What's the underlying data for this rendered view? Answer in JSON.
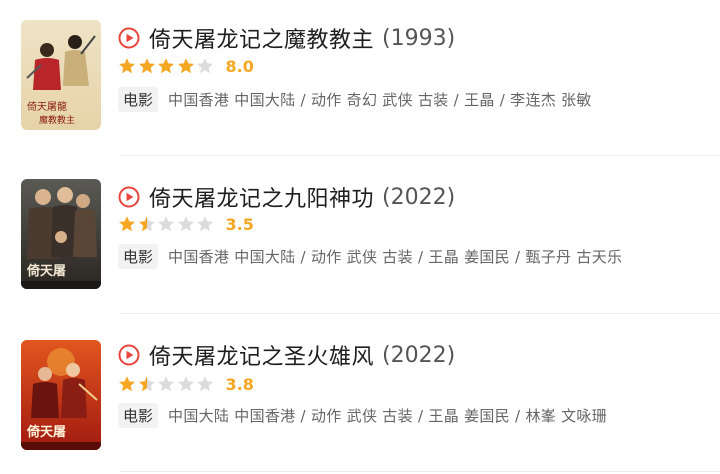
{
  "items": [
    {
      "title": "倚天屠龙记之魔教教主",
      "year": "(1993)",
      "rating": 4,
      "score": "8.0",
      "tag": "电影",
      "meta": "中国香港 中国大陆 / 动作 奇幻 武侠 古装 / 王晶 / 李连杰 张敏",
      "poster_text": "倚天屠龍記之魔教教主"
    },
    {
      "title": "倚天屠龙记之九阳神功",
      "year": "(2022)",
      "rating": 1.5,
      "score": "3.5",
      "tag": "电影",
      "meta": "中国香港 中国大陆 / 动作 武侠 古装 / 王晶 姜国民 / 甄子丹 古天乐",
      "poster_text": "倚天屠龍記"
    },
    {
      "title": "倚天屠龙记之圣火雄风",
      "year": "(2022)",
      "rating": 1.5,
      "score": "3.8",
      "tag": "电影",
      "meta": "中国大陆 中国香港 / 动作 武侠 古装 / 王晶 姜国民 / 林峯 文咏珊",
      "poster_text": "倚天屠龍記"
    }
  ],
  "colors": {
    "accent": "#e8453c",
    "star": "#f5a623",
    "star_empty": "#dcdcdc"
  }
}
